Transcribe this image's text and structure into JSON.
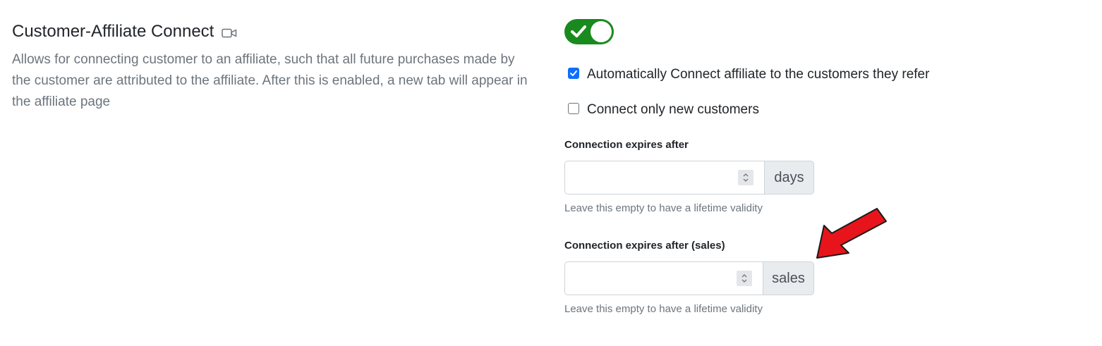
{
  "setting": {
    "title": "Customer-Affiliate Connect",
    "title_icon": "video-camera-icon",
    "description": "Allows for connecting customer to an affiliate, such that all future purchases made by the customer are attributed to the affiliate. After this is enabled, a new tab will appear in the affiliate page"
  },
  "toggle": {
    "state": "on",
    "color": "#198a1e",
    "icon": "checkmark-icon"
  },
  "options": {
    "auto_connect": {
      "label": "Automatically Connect affiliate to the customers they refer",
      "checked": true
    },
    "new_only": {
      "label": "Connect only new customers",
      "checked": false
    }
  },
  "expire_days": {
    "label": "Connection expires after",
    "value": "",
    "unit": "days",
    "help": "Leave this empty to have a lifetime validity"
  },
  "expire_sales": {
    "label": "Connection expires after (sales)",
    "value": "",
    "unit": "sales",
    "help": "Leave this empty to have a lifetime validity"
  },
  "annotation": {
    "type": "red-arrow-icon",
    "color": "#e8141b"
  }
}
